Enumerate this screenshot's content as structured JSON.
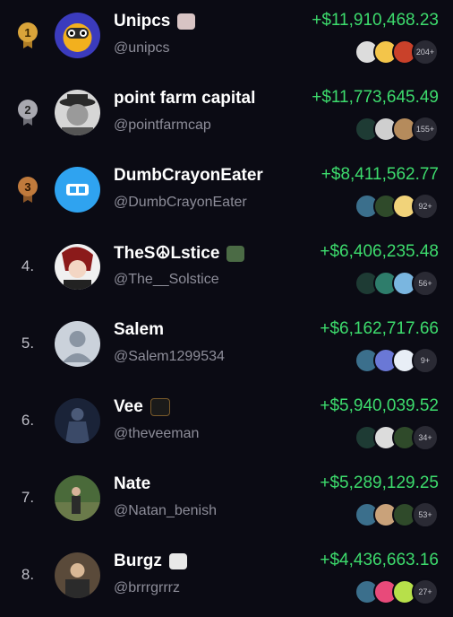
{
  "leaderboard": [
    {
      "rank": "1",
      "name": "Unipcs",
      "handle": "@unipcs",
      "pnl": "+$11,910,468.23",
      "token_count": "204+",
      "has_badge": true
    },
    {
      "rank": "2",
      "name": "point farm capital",
      "handle": "@pointfarmcap",
      "pnl": "+$11,773,645.49",
      "token_count": "155+",
      "has_badge": false
    },
    {
      "rank": "3",
      "name": "DumbCrayonEater",
      "handle": "@DumbCrayonEater",
      "pnl": "+$8,411,562.77",
      "token_count": "92+",
      "has_badge": false
    },
    {
      "rank": "4.",
      "name": "TheS☮Lstice",
      "handle": "@The__Solstice",
      "pnl": "+$6,406,235.48",
      "token_count": "56+",
      "has_badge": true
    },
    {
      "rank": "5.",
      "name": "Salem",
      "handle": "@Salem1299534",
      "pnl": "+$6,162,717.66",
      "token_count": "9+",
      "has_badge": false
    },
    {
      "rank": "6.",
      "name": "Vee",
      "handle": "@theveeman",
      "pnl": "+$5,940,039.52",
      "token_count": "34+",
      "has_badge": true
    },
    {
      "rank": "7.",
      "name": "Nate",
      "handle": "@Natan_benish",
      "pnl": "+$5,289,129.25",
      "token_count": "53+",
      "has_badge": false
    },
    {
      "rank": "8.",
      "name": "Burgz",
      "handle": "@brrrgrrrz",
      "pnl": "+$4,436,663.16",
      "token_count": "27+",
      "has_badge": true
    }
  ],
  "colors": {
    "background": "#0b0b14",
    "pnl_positive": "#3ddc6d",
    "handle": "#8d8d99",
    "gold": "#d9a43a",
    "silver": "#a8a8b0",
    "bronze": "#c07a3c"
  },
  "icons": {
    "medal_top3": "medal-icon",
    "token": "token-icon",
    "badge": "badge-icon"
  }
}
